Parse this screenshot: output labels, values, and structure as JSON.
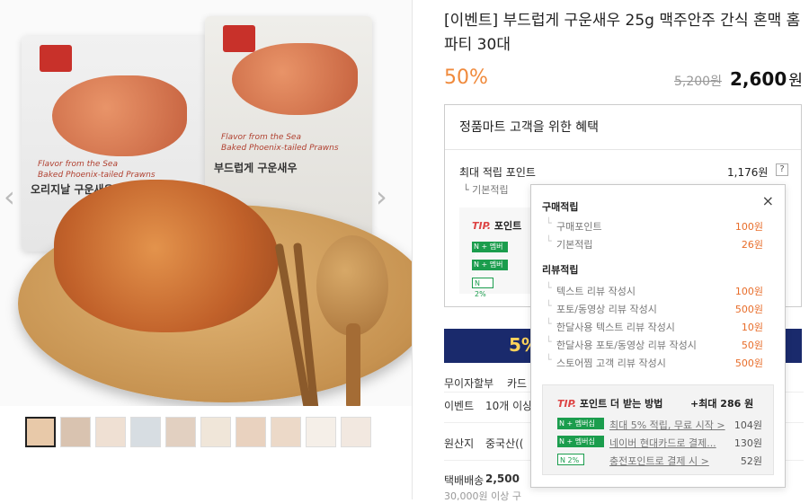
{
  "product": {
    "title": "[이벤트] 부드럽게 구운새우 25g 맥주안주 간식 혼맥 홈파티 30대",
    "discount": "50%",
    "original_price": "5,200원",
    "price": "2,600",
    "price_unit": "원"
  },
  "packages": {
    "left_name": "오리지날 구운새우",
    "right_name": "부드럽게 구운새우",
    "sub": "Flavor from the Sea",
    "sub2": "Baked Phoenix-tailed Prawns"
  },
  "benefit": {
    "heading": "정품마트 고객을 위한 혜택",
    "max_points_label": "최대 적립 포인트",
    "max_points_value": "1,176원",
    "help": "?",
    "basic_label": "기본적립",
    "tip": "TIP.",
    "tip_text": "포인트",
    "badge_membership": "N + 멤버십",
    "badge_two": "N 2%",
    "banner_text": "5%"
  },
  "info": {
    "installment": "무이자할부",
    "installment_val": "카드",
    "event": "이벤트",
    "event_val": "10개 이상",
    "origin": "원산지",
    "origin_val": "중국산((",
    "shipping": "택배배송",
    "shipping_val": "2,500",
    "shipping_note": "30,000원 이상 구"
  },
  "popup": {
    "close": "×",
    "purchase_title": "구매적립",
    "purchase_items": [
      {
        "label": "구매포인트",
        "value": "100원"
      },
      {
        "label": "기본적립",
        "value": "26원"
      }
    ],
    "review_title": "리뷰적립",
    "review_items": [
      {
        "label": "텍스트 리뷰 작성시",
        "value": "100원"
      },
      {
        "label": "포토/동영상 리뷰 작성시",
        "value": "500원"
      },
      {
        "label": "한달사용 텍스트 리뷰 작성시",
        "value": "10원"
      },
      {
        "label": "한달사용 포토/동영상 리뷰 작성시",
        "value": "50원"
      },
      {
        "label": "스토어찜 고객 리뷰 작성시",
        "value": "500원"
      }
    ],
    "more": {
      "tip": "TIP.",
      "heading": "포인트 더 받는 방법",
      "max": "+최대 286 원",
      "rows": [
        {
          "badge": "N + 멤버십",
          "text": "최대 5% 적립, 무료 시작 >",
          "value": "104원"
        },
        {
          "badge": "N + 멤버십",
          "text": "네이버 현대카드로 결제...",
          "value": "130원"
        },
        {
          "badge": "N 2%",
          "text": "충전포인트로 결제 시 >",
          "value": "52원"
        }
      ]
    }
  },
  "colors": {
    "discount": "#f08a3c",
    "point_value": "#e86d2a",
    "naver_green": "#1b9d4d",
    "banner": "#1a2a6c"
  }
}
